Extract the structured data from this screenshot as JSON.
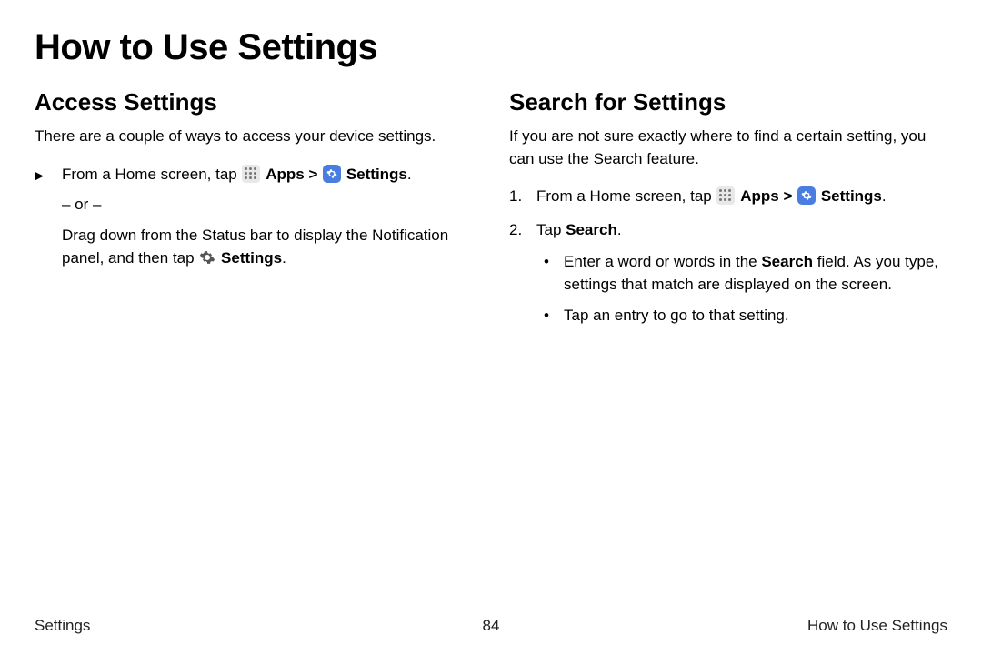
{
  "title": "How to Use Settings",
  "left": {
    "heading": "Access Settings",
    "intro": "There are a couple of ways to access your device settings.",
    "step_prefix": "From a Home screen, tap ",
    "apps_label": "Apps",
    "caret": " > ",
    "settings_label": "Settings",
    "period": ".",
    "or_text": "– or –",
    "alt_prefix": "Drag down from the Status bar to display the Notification panel, and then tap ",
    "alt_settings": "Settings",
    "alt_period": "."
  },
  "right": {
    "heading": "Search for Settings",
    "intro": "If you are not sure exactly where to find a certain setting, you can use the Search feature.",
    "step1_prefix": "From a Home screen, tap ",
    "apps_label": "Apps",
    "caret": " > ",
    "settings_label": "Settings",
    "period": ".",
    "step2_prefix": "Tap ",
    "step2_bold": "Search",
    "step2_period": ".",
    "bullet1_a": "Enter a word or words in the ",
    "bullet1_bold": "Search",
    "bullet1_b": " field. As you type, settings that match are displayed on the screen.",
    "bullet2": "Tap an entry to go to that setting."
  },
  "footer": {
    "left": "Settings",
    "center": "84",
    "right": "How to Use Settings"
  }
}
